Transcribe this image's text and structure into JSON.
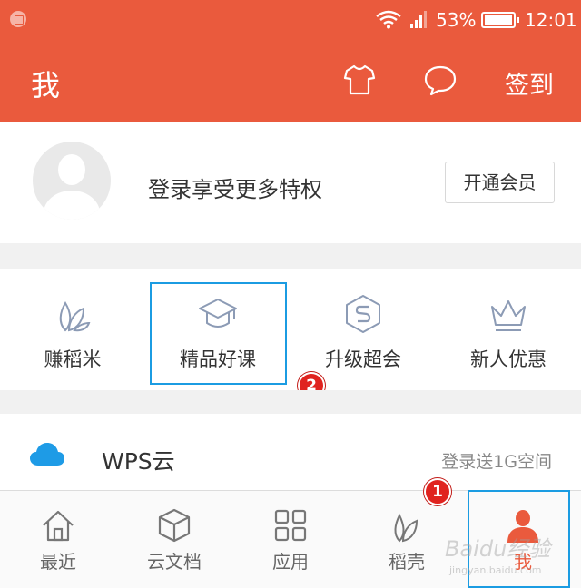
{
  "statusbar": {
    "battery": "53%",
    "time": "12:01"
  },
  "header": {
    "title": "我",
    "signin_label": "签到"
  },
  "profile": {
    "login_prompt": "登录享受更多特权",
    "vip_button": "开通会员"
  },
  "features": [
    {
      "label": "赚稻米",
      "icon": "leaf-icon"
    },
    {
      "label": "精品好课",
      "icon": "graduation-cap-icon"
    },
    {
      "label": "升级超会",
      "icon": "hexagon-s-icon"
    },
    {
      "label": "新人优惠",
      "icon": "crown-icon"
    }
  ],
  "cloud": {
    "title": "WPS云",
    "subtitle": "登录送1G空间"
  },
  "tabs": [
    {
      "label": "最近",
      "icon": "home-icon"
    },
    {
      "label": "云文档",
      "icon": "cube-icon"
    },
    {
      "label": "应用",
      "icon": "grid-icon"
    },
    {
      "label": "稻壳",
      "icon": "leaf-icon"
    },
    {
      "label": "我",
      "icon": "user-icon",
      "active": true
    }
  ],
  "markers": {
    "first": "1",
    "second": "2"
  },
  "watermark": {
    "main": "Baidu经验",
    "sub": "jingyan.baidu.com"
  },
  "colors": {
    "accent": "#ea5a3d",
    "highlight": "#1b9ce2",
    "marker": "#e0231f"
  }
}
